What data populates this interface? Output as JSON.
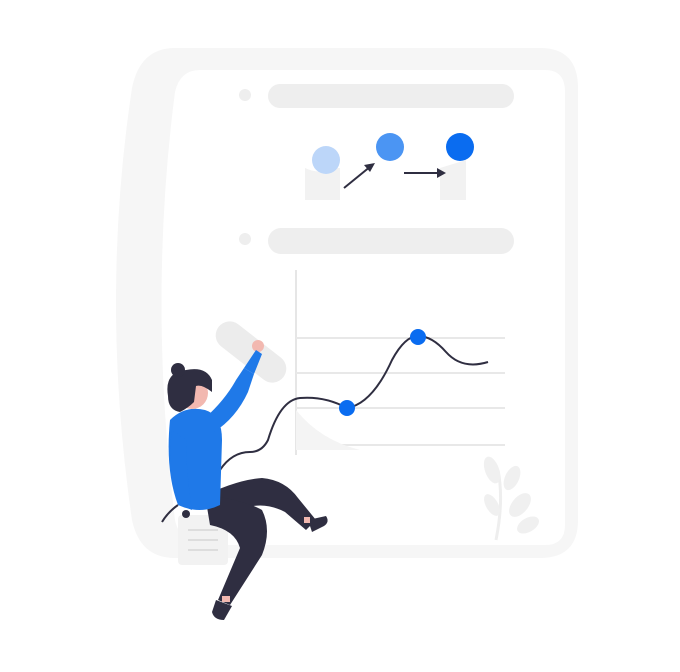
{
  "illustration": {
    "description_tag": "",
    "palette": {
      "background": "#ffffff",
      "board": "#f5f5f5",
      "board_edge": "#eeeeee",
      "pill": "#ededed",
      "accent": "#0a6cf0",
      "accent_mid": "#4b95f3",
      "accent_light": "#bcd6f9",
      "ink": "#2f2e41",
      "sweater": "#1f79e8",
      "skin": "#f2b8b0",
      "hair": "#2f2e41",
      "paper": "#f2f2f2"
    },
    "icons": {
      "dot_light": "progress-dot-light-icon",
      "dot_mid": "progress-dot-mid-icon",
      "dot_dark": "progress-dot-dark-icon",
      "arrow_up": "arrow-up-right-icon",
      "arrow_right": "arrow-right-icon",
      "plant": "plant-leaves-icon",
      "document": "document-page-icon"
    }
  }
}
